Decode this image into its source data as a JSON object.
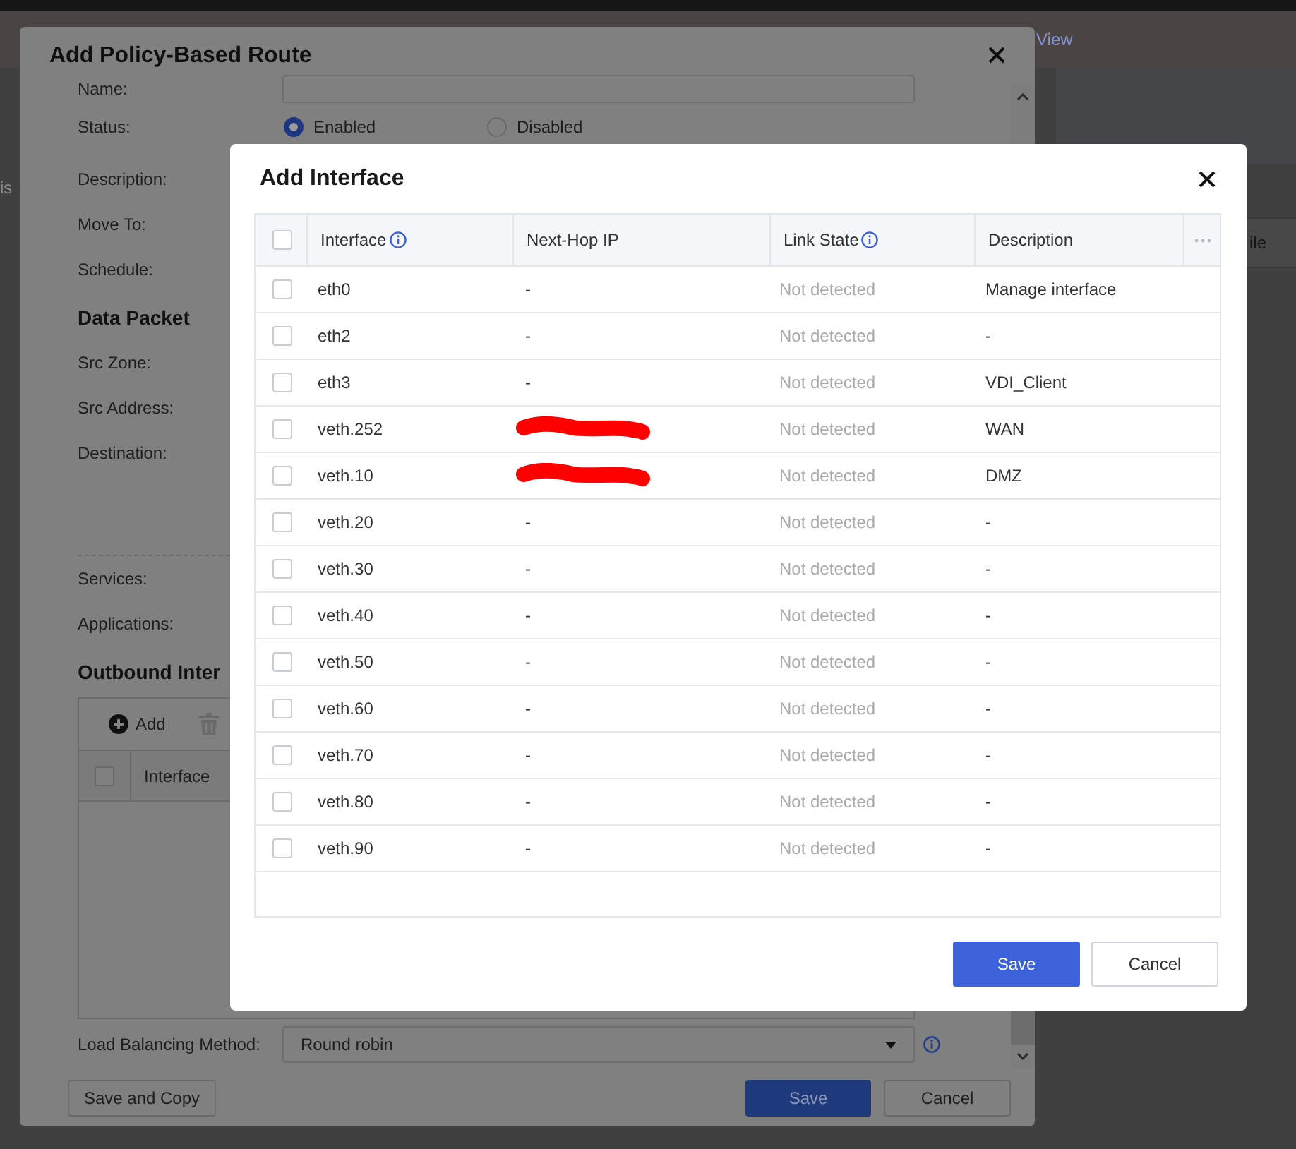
{
  "background_page": {
    "header_link": "View",
    "fragment_left": "is",
    "fragment_right": "ile"
  },
  "policy_dialog": {
    "title": "Add Policy-Based Route",
    "fields": [
      {
        "kind": "input",
        "label": "Name:"
      },
      {
        "kind": "radio",
        "label": "Status:",
        "options": [
          {
            "label": "Enabled",
            "selected": true
          },
          {
            "label": "Disabled",
            "selected": false
          }
        ]
      },
      {
        "kind": "label",
        "label": "Description:"
      },
      {
        "kind": "label",
        "label": "Move To:"
      },
      {
        "kind": "label",
        "label": "Schedule:"
      },
      {
        "kind": "heading",
        "label": "Data Packet"
      },
      {
        "kind": "label",
        "label": "Src Zone:"
      },
      {
        "kind": "label",
        "label": "Src Address:"
      },
      {
        "kind": "area",
        "label": "Destination:"
      },
      {
        "kind": "label",
        "label": "Services:"
      },
      {
        "kind": "label",
        "label": "Applications:"
      },
      {
        "kind": "heading",
        "label": "Outbound Inter"
      }
    ],
    "outbound_table": {
      "toolbar": [
        {
          "kind": "add",
          "label": "Add"
        },
        {
          "kind": "delete"
        }
      ],
      "select_all_checked": false,
      "columns": [
        "Interface"
      ]
    },
    "load_balancing": {
      "label": "Load Balancing Method:",
      "value": "Round robin"
    },
    "buttons": [
      {
        "kind": "secondary",
        "label": "Save and Copy"
      },
      {
        "kind": "primary",
        "label": "Save"
      },
      {
        "kind": "secondary",
        "label": "Cancel"
      }
    ]
  },
  "interface_dialog": {
    "title": "Add Interface",
    "table": {
      "select_all_checked": false,
      "columns": [
        {
          "label": "Interface",
          "info": true
        },
        {
          "label": "Next-Hop IP",
          "info": false
        },
        {
          "label": "Link State",
          "info": true
        },
        {
          "label": "Description",
          "info": false
        }
      ],
      "rows": [
        {
          "checked": false,
          "interface": "eth0",
          "redacted": false,
          "next_hop_ip": "-",
          "link_state": "Not detected",
          "description": "Manage interface"
        },
        {
          "checked": false,
          "interface": "eth2",
          "redacted": false,
          "next_hop_ip": "-",
          "link_state": "Not detected",
          "description": "-"
        },
        {
          "checked": false,
          "interface": "eth3",
          "redacted": false,
          "next_hop_ip": "-",
          "link_state": "Not detected",
          "description": "VDI_Client"
        },
        {
          "checked": false,
          "interface": "veth.252",
          "redacted": true,
          "link_state": "Not detected",
          "description": "WAN"
        },
        {
          "checked": false,
          "interface": "veth.10",
          "redacted": true,
          "link_state": "Not detected",
          "description": "DMZ"
        },
        {
          "checked": false,
          "interface": "veth.20",
          "redacted": false,
          "next_hop_ip": "-",
          "link_state": "Not detected",
          "description": "-"
        },
        {
          "checked": false,
          "interface": "veth.30",
          "redacted": false,
          "next_hop_ip": "-",
          "link_state": "Not detected",
          "description": "-"
        },
        {
          "checked": false,
          "interface": "veth.40",
          "redacted": false,
          "next_hop_ip": "-",
          "link_state": "Not detected",
          "description": "-"
        },
        {
          "checked": false,
          "interface": "veth.50",
          "redacted": false,
          "next_hop_ip": "-",
          "link_state": "Not detected",
          "description": "-"
        },
        {
          "checked": false,
          "interface": "veth.60",
          "redacted": false,
          "next_hop_ip": "-",
          "link_state": "Not detected",
          "description": "-"
        },
        {
          "checked": false,
          "interface": "veth.70",
          "redacted": false,
          "next_hop_ip": "-",
          "link_state": "Not detected",
          "description": "-"
        },
        {
          "checked": false,
          "interface": "veth.80",
          "redacted": false,
          "next_hop_ip": "-",
          "link_state": "Not detected",
          "description": "-"
        },
        {
          "checked": false,
          "interface": "veth.90",
          "redacted": false,
          "next_hop_ip": "-",
          "link_state": "Not detected",
          "description": "-"
        }
      ]
    },
    "buttons": [
      {
        "kind": "primary",
        "label": "Save"
      },
      {
        "kind": "secondary",
        "label": "Cancel"
      }
    ]
  }
}
